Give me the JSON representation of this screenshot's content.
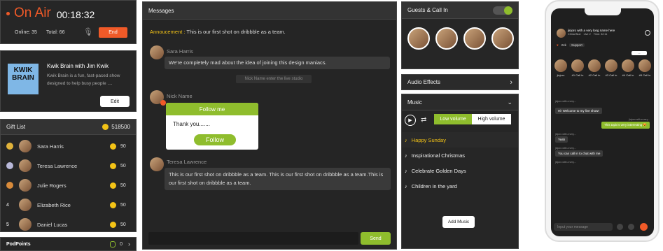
{
  "onair": {
    "title": "On Air",
    "time": "00:18:32",
    "online": "Online: 35",
    "total": "Total: 66",
    "end": "End"
  },
  "show": {
    "name": "Kwik Brain with Jim Kwik",
    "desc1": "Kwik Brain is a fun, fast-paced show",
    "desc2": "designed to help busy people ....",
    "edit": "Edit",
    "logo1": "KWIK",
    "logo2": "BRAIN"
  },
  "gifts": {
    "title": "Gift List",
    "total": "518500",
    "rows": [
      {
        "rank": "",
        "name": "Sara Harris",
        "val": "90"
      },
      {
        "rank": "",
        "name": "Teresa Lawrence",
        "val": "50"
      },
      {
        "rank": "",
        "name": "Julie Rogers",
        "val": "50"
      },
      {
        "rank": "4",
        "name": "Elizabeth Rice",
        "val": "50"
      },
      {
        "rank": "5",
        "name": "Daniel Lucas",
        "val": "50"
      }
    ]
  },
  "podpoints": {
    "label": "PodPoints",
    "val": "0"
  },
  "messages": {
    "title": "Messages",
    "ann_label": "Annoucement :",
    "ann_text": "This is our first shot on dribbble as a team.",
    "m1_name": "Sara Harris",
    "m1_text": "We're completely mad about the idea of joining this design maniacs.",
    "system": "Nick Name enter the live studio",
    "m2_name": "Nick Name",
    "follow_title": "Follow me",
    "follow_text": "Thank you.......",
    "follow_btn": "Follow",
    "m3_name": "Teresa Lawrence",
    "m3_text": "This is our first shot on dribbble as a team. This is our first shot on dribbble as a team.This is our first shot on dribbble as a team.",
    "send": "Send"
  },
  "guests": {
    "title": "Guests & Call In"
  },
  "audio": {
    "title": "Audio Effects"
  },
  "music": {
    "title": "Music",
    "low": "Low volume",
    "high": "High volume",
    "tracks": [
      "Happy Sunday",
      "Inspirational Christmas",
      "Celebrate Golden Days",
      "Children in the yard"
    ],
    "add": "Add Music"
  },
  "phone": {
    "host": "jinjoro with a very long name here",
    "sub1": "China Blue",
    "sub2": "Live  2",
    "sub3": "Time: 32:11",
    "likes": "24k",
    "support": "Support",
    "ellipsis": "...",
    "guests": [
      "jinjoro",
      "#1 Call in",
      "#2 Call in",
      "#3 Call in",
      "#4 Call in",
      "#5 Call in"
    ],
    "msgs": [
      {
        "side": "l",
        "name": "jinjoro with a very...",
        "text": ""
      },
      {
        "side": "l",
        "name": "",
        "text": "Hi! Welcome to my live show!"
      },
      {
        "side": "r",
        "name": "jinjoro with a very...",
        "text": "This topic's very interesting 😍"
      },
      {
        "side": "l",
        "name": "jinjoro with a very...",
        "text": "Yeah"
      },
      {
        "side": "l",
        "name": "jinjoro with a very...",
        "text": "You can call in to chat with me"
      },
      {
        "side": "l",
        "name": "jinjoro with a very...",
        "text": ""
      }
    ],
    "input": "Input your message"
  },
  "colors": {
    "accent": "#8fbd2d",
    "brand": "#f05a28",
    "coin": "#f3c316"
  }
}
